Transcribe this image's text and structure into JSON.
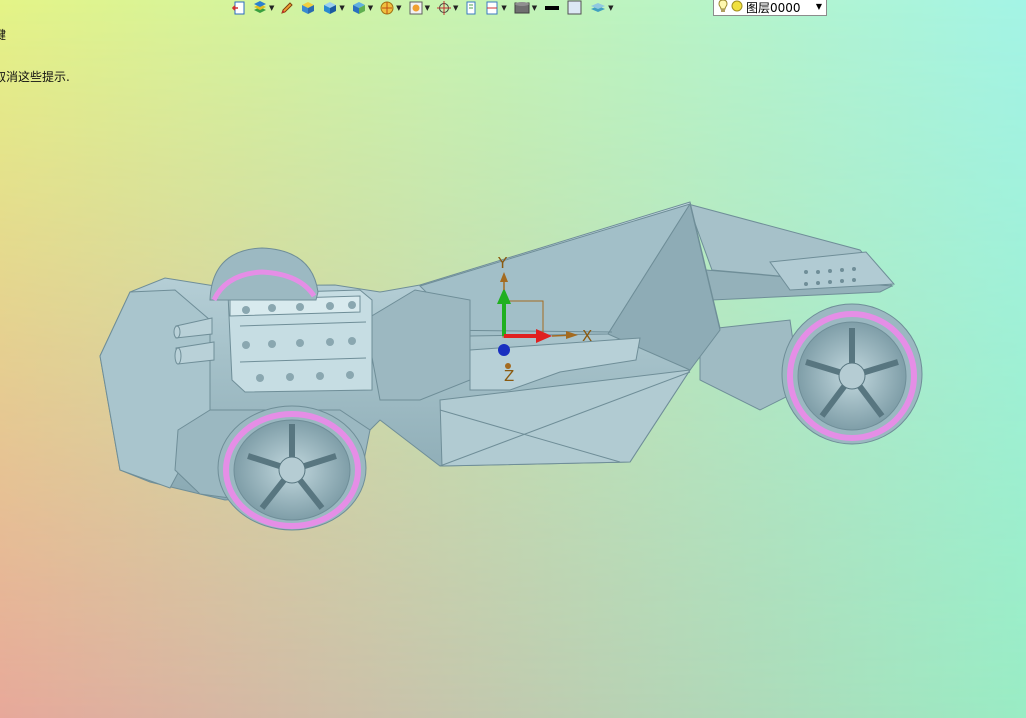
{
  "hint": {
    "line1": "键",
    "line2": "取消这些提示."
  },
  "toolbar": {
    "items": [
      {
        "icon": "exit-sketch-icon",
        "dropdown": false
      },
      {
        "icon": "layers-stack-icon",
        "dropdown": true
      },
      {
        "icon": "pencil-icon",
        "dropdown": false
      },
      {
        "icon": "solid-block-icon",
        "dropdown": false
      },
      {
        "icon": "box-view-icon",
        "dropdown": true
      },
      {
        "icon": "shaded-cube-icon",
        "dropdown": true
      },
      {
        "icon": "sphere-render-icon",
        "dropdown": true
      },
      {
        "icon": "frame-view-icon",
        "dropdown": true
      },
      {
        "icon": "target-snap-icon",
        "dropdown": true
      },
      {
        "icon": "document-icon",
        "dropdown": false
      },
      {
        "icon": "measure-icon",
        "dropdown": true
      },
      {
        "icon": "display-style-icon",
        "dropdown": true
      },
      {
        "icon": "line-color-icon",
        "dropdown": false
      },
      {
        "icon": "fill-color-icon",
        "dropdown": false
      },
      {
        "icon": "layer-manager-icon",
        "dropdown": true
      }
    ],
    "dropdown_glyph": "▼"
  },
  "layer_select": {
    "value": "图层0000",
    "arrow": "▼"
  },
  "axes": {
    "x_label": "X",
    "y_label": "Y",
    "z_label": "Z",
    "x_color": "#e02020",
    "y_color": "#20b020",
    "z_color": "#1a30c0",
    "label_color": "#8a5a10"
  },
  "colors": {
    "background_top_left": "#e4f487",
    "background_top_right": "#a4f4e6",
    "background_bottom_left": "#e7a89a",
    "background_bottom_right": "#99ecc4",
    "model_body": "#a8c4cc",
    "tire_accent": "#e58ee6"
  }
}
